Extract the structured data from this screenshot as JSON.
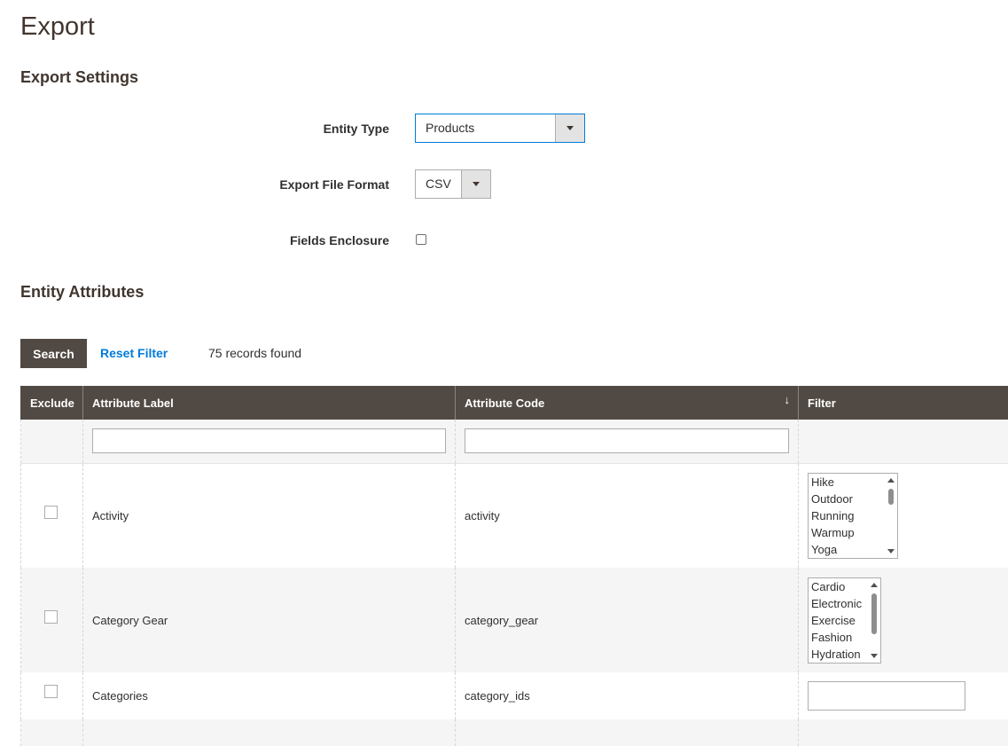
{
  "page": {
    "title": "Export"
  },
  "export_settings": {
    "title": "Export Settings",
    "entity_type": {
      "label": "Entity Type",
      "value": "Products"
    },
    "file_format": {
      "label": "Export File Format",
      "value": "CSV"
    },
    "fields_enclosure": {
      "label": "Fields Enclosure",
      "checked": false
    }
  },
  "entity_attributes": {
    "title": "Entity Attributes",
    "search_label": "Search",
    "reset_label": "Reset Filter",
    "records_found": "75 records found",
    "columns": {
      "exclude": "Exclude",
      "label": "Attribute Label",
      "code": "Attribute Code",
      "filter": "Filter"
    },
    "sort_indicator": "↓",
    "rows": [
      {
        "label": "Activity",
        "code": "activity",
        "filter_options": [
          "Hike",
          "Outdoor",
          "Running",
          "Warmup",
          "Yoga"
        ]
      },
      {
        "label": "Category Gear",
        "code": "category_gear",
        "filter_options": [
          "Cardio",
          "Electronic",
          "Exercise",
          "Fashion",
          "Hydration"
        ]
      },
      {
        "label": "Categories",
        "code": "category_ids"
      }
    ]
  },
  "colors": {
    "header_bg": "#514943",
    "link": "#007bdb",
    "focus_border": "#007bdb"
  }
}
